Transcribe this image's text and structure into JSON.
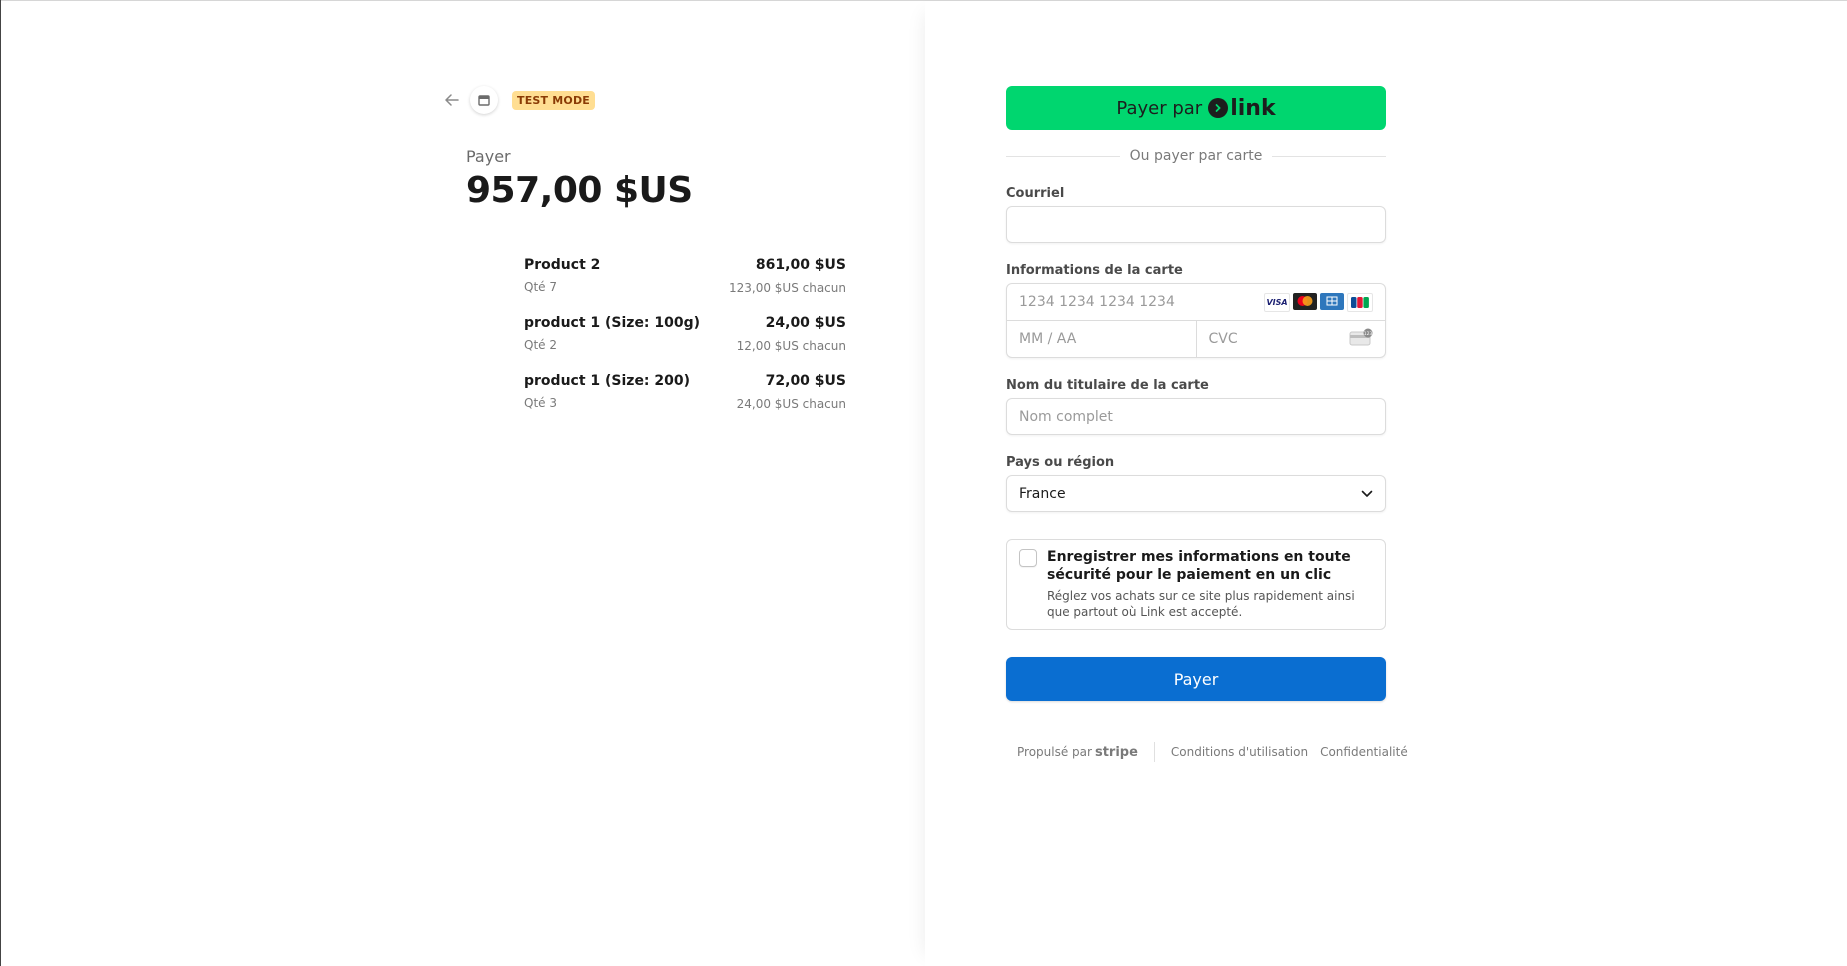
{
  "header": {
    "badge": "TEST MODE"
  },
  "summary": {
    "pay_label": "Payer",
    "total": "957,00 $US",
    "items": [
      {
        "name": "Product 2",
        "qty": "Qté 7",
        "price": "861,00 $US",
        "unit": "123,00 $US chacun"
      },
      {
        "name": "product 1 (Size: 100g)",
        "qty": "Qté 2",
        "price": "24,00 $US",
        "unit": "12,00 $US chacun"
      },
      {
        "name": "product 1 (Size: 200)",
        "qty": "Qté 3",
        "price": "72,00 $US",
        "unit": "24,00 $US chacun"
      }
    ]
  },
  "form": {
    "link_button_prefix": "Payer par",
    "link_logo_text": "link",
    "divider_text": "Ou payer par carte",
    "email_label": "Courriel",
    "email_value": "",
    "card_label": "Informations de la carte",
    "card_number_placeholder": "1234 1234 1234 1234",
    "card_brands": [
      "VISA",
      "mastercard",
      "amex",
      "jcb"
    ],
    "expiry_placeholder": "MM / AA",
    "cvc_placeholder": "CVC",
    "name_label": "Nom du titulaire de la carte",
    "name_placeholder": "Nom complet",
    "country_label": "Pays ou région",
    "country_value": "France",
    "save_title": "Enregistrer mes informations en toute sécurité pour le paiement en un clic",
    "save_desc": "Réglez vos achats sur ce site plus rapidement ainsi que partout où Link est accepté.",
    "save_checked": false,
    "pay_button": "Payer"
  },
  "footer": {
    "powered_by": "Propulsé par",
    "stripe": "stripe",
    "terms": "Conditions d'utilisation",
    "privacy": "Confidentialité"
  },
  "colors": {
    "link_green": "#00d66f",
    "pay_blue": "#0a6ed1",
    "badge_bg": "#ffde92",
    "badge_text": "#8a3b05"
  }
}
